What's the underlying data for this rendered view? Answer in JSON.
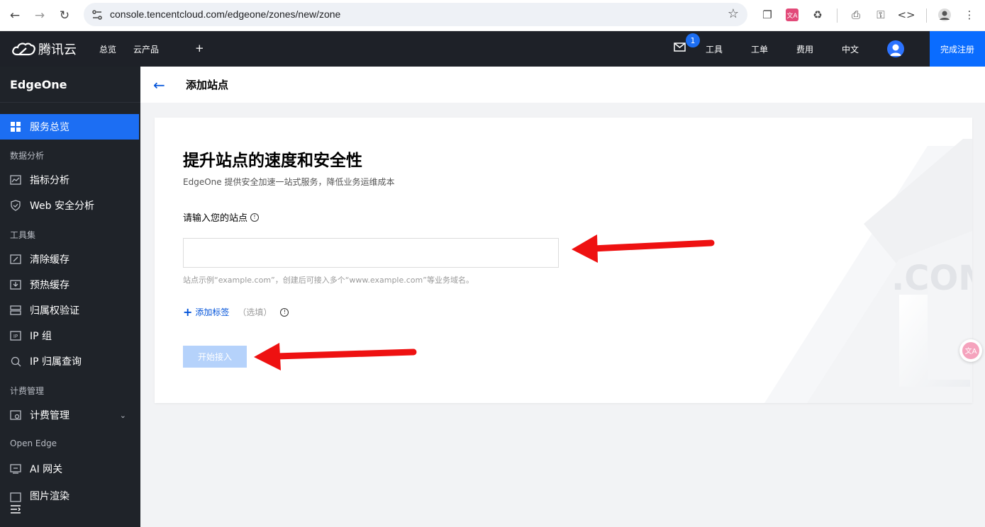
{
  "browser": {
    "url": "console.tencentcloud.com/edgeone/zones/new/zone"
  },
  "topnav": {
    "brand": "腾讯云",
    "overview": "总览",
    "products": "云产品",
    "plus": "+",
    "mail_badge": "1",
    "tools": "工具",
    "tickets": "工单",
    "billing": "费用",
    "language": "中文",
    "register": "完成注册"
  },
  "sidebar": {
    "title": "EdgeOne",
    "items": [
      {
        "label": "服务总览",
        "icon": "grid-icon",
        "active": true
      },
      {
        "group": "数据分析"
      },
      {
        "label": "指标分析",
        "icon": "chart-icon"
      },
      {
        "label": "Web 安全分析",
        "icon": "shield-icon"
      },
      {
        "group": "工具集"
      },
      {
        "label": "清除缓存",
        "icon": "clear-cache-icon"
      },
      {
        "label": "预热缓存",
        "icon": "prefetch-icon"
      },
      {
        "label": "归属权验证",
        "icon": "verify-icon"
      },
      {
        "label": "IP 组",
        "icon": "ip-icon"
      },
      {
        "label": "IP 归属查询",
        "icon": "search-icon"
      },
      {
        "group": "计费管理"
      },
      {
        "label": "计费管理",
        "icon": "billing-icon"
      },
      {
        "group": "Open Edge"
      },
      {
        "label": "AI 网关",
        "icon": "gateway-icon"
      },
      {
        "label": "图片渲染",
        "icon": "image-icon"
      }
    ]
  },
  "page": {
    "title": "添加站点"
  },
  "card": {
    "heading": "提升站点的速度和安全性",
    "subheading": "EdgeOne 提供安全加速一站式服务，降低业务运维成本",
    "field_label": "请输入您的站点",
    "input_value": "",
    "hint": "站点示例“example.com”，创建后可接入多个“www.example.com”等业务域名。",
    "add_tag": "添加标签",
    "optional": "（选填）",
    "start_button": "开始接入",
    "deco_text": ".COM"
  },
  "colors": {
    "accent": "#1c6ef3",
    "annotation_arrow": "#ee1111"
  }
}
